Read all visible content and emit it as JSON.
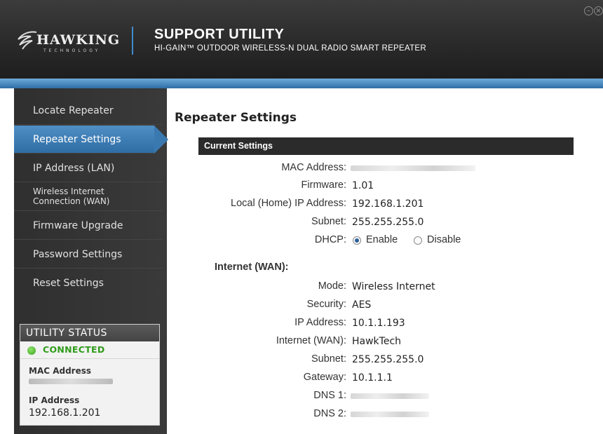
{
  "header": {
    "brand": "HAWKING",
    "brand_sub": "TECHNOLOGY",
    "title": "SUPPORT UTILITY",
    "subtitle": "HI-GAIN™ OUTDOOR WIRELESS-N DUAL RADIO SMART REPEATER",
    "minimize_glyph": "–",
    "close_glyph": "×"
  },
  "sidebar": {
    "items": [
      {
        "label": "Locate Repeater"
      },
      {
        "label": "Repeater Settings",
        "active": true
      },
      {
        "label": "IP Address (LAN)"
      },
      {
        "label_line1": "Wireless Internet",
        "label_line2": "Connection (WAN)"
      },
      {
        "label": "Firmware Upgrade"
      },
      {
        "label": "Password Settings"
      },
      {
        "label": "Reset Settings"
      }
    ]
  },
  "status": {
    "heading": "UTILITY STATUS",
    "state": "CONNECTED",
    "mac_label": "MAC Address",
    "ip_label": "IP Address",
    "ip_value": "192.168.1.201",
    "accent_color": "#2f9c1a"
  },
  "main": {
    "title": "Repeater Settings",
    "current_settings_label": "Current Settings",
    "current": {
      "mac_label": "MAC Address:",
      "firmware_label": "Firmware:",
      "firmware_value": "1.01",
      "local_ip_label": "Local (Home) IP Address:",
      "local_ip_value": "192.168.1.201",
      "subnet_label": "Subnet:",
      "subnet_value": "255.255.255.0",
      "dhcp_label": "DHCP:",
      "dhcp_enable": "Enable",
      "dhcp_disable": "Disable",
      "dhcp_selected": "Enable"
    },
    "wan_heading": "Internet (WAN):",
    "wan": {
      "mode_label": "Mode:",
      "mode_value": "Wireless Internet",
      "security_label": "Security:",
      "security_value": "AES",
      "ip_label": "IP Address:",
      "ip_value": "10.1.1.193",
      "internet_label": "Internet (WAN):",
      "internet_value": "HawkTech",
      "subnet_label": "Subnet:",
      "subnet_value": "255.255.255.0",
      "gateway_label": "Gateway:",
      "gateway_value": "10.1.1.1",
      "dns1_label": "DNS 1:",
      "dns2_label": "DNS 2:"
    }
  },
  "colors": {
    "accent_blue": "#3a78b0",
    "sidebar_bg": "#333333",
    "header_bg": "#2a2a2a"
  }
}
